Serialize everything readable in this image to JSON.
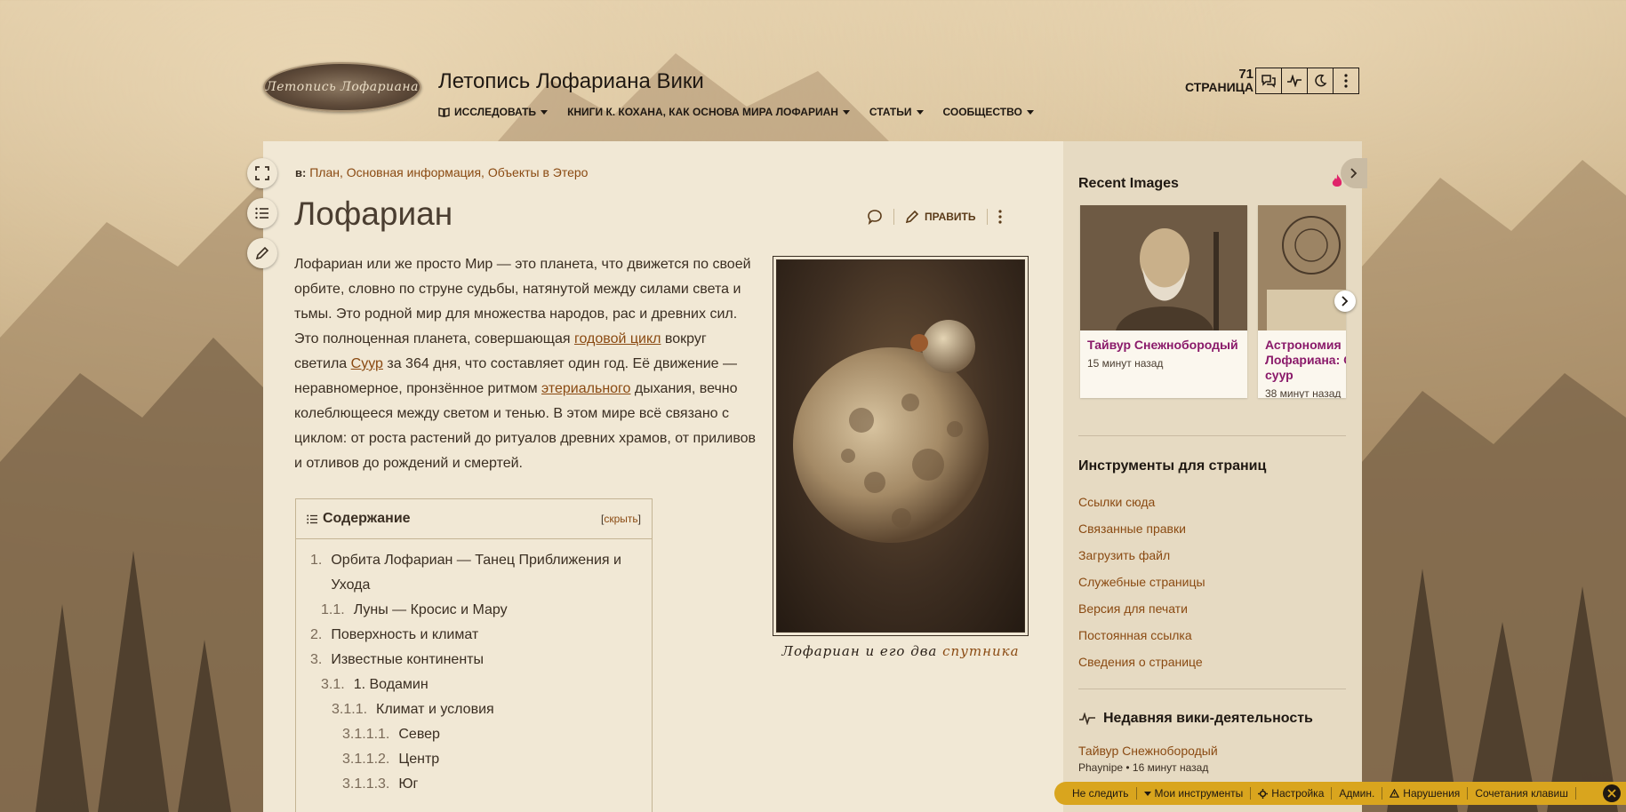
{
  "header": {
    "logo_text": "Летопись Лофариана",
    "wiki_title": "Летопись Лофариана Вики",
    "nav": [
      {
        "label": "Исследовать"
      },
      {
        "label": "Книги К. Кохана, как основа мира Лофариан"
      },
      {
        "label": "Статьи"
      },
      {
        "label": "Сообщество"
      }
    ],
    "pages_count": "71",
    "pages_label": "СТРАНИЦА"
  },
  "article": {
    "categories_prefix": "в:",
    "categories": "План, Основная информация, Объекты в Этеро",
    "title": "Лофариан",
    "edit_label": "Править",
    "intro_parts": {
      "p1": "Лофариан или же просто Мир — это планета, что движется по своей орбите, словно по струне судьбы, натянутой между силами света и тьмы. Это родной мир для множества народов, рас и древних сил. Это полноценная планета, совершающая ",
      "l1": "годовой цикл",
      "p2": " вокруг светила ",
      "l2": "Суур",
      "p3": " за 364 дня, что составляет один год. Её движение — неравномерное, пронзённое ритмом ",
      "l3": "этериального",
      "p4": " дыхания, вечно колеблющееся между светом и тенью. В этом мире всё связано с циклом: от роста растений до ритуалов древних храмов, от приливов и отливов до рождений и смертей."
    },
    "caption_text": "Лофариан и его два ",
    "caption_link": "спутника",
    "toc": {
      "title": "Содержание",
      "hide_label": "скрыть",
      "items": [
        {
          "num": "1.",
          "text": "Орбита Лофариан — Танец Приближения и Ухода",
          "indent": 0
        },
        {
          "num": "1.1.",
          "text": "Луны — Кросис и Мару",
          "indent": 1
        },
        {
          "num": "2.",
          "text": "Поверхность и климат",
          "indent": 0
        },
        {
          "num": "3.",
          "text": "Известные континенты",
          "indent": 0
        },
        {
          "num": "3.1.",
          "text": "1. Водамин",
          "indent": 1
        },
        {
          "num": "3.1.1.",
          "text": "Климат и условия",
          "indent": 2
        },
        {
          "num": "3.1.1.1.",
          "text": "Север",
          "indent": 3
        },
        {
          "num": "3.1.1.2.",
          "text": "Центр",
          "indent": 3
        },
        {
          "num": "3.1.1.3.",
          "text": "Юг",
          "indent": 3
        }
      ]
    }
  },
  "rail": {
    "recent_images_title": "Recent Images",
    "images": [
      {
        "title": "Тайвур Снежнобородый",
        "time": "15 минут назад"
      },
      {
        "title": "Астрономия Лофариана: Орбиты, суур",
        "time": "38 минут назад"
      }
    ],
    "tools_title": "Инструменты для страниц",
    "tools": [
      "Ссылки сюда",
      "Связанные правки",
      "Загрузить файл",
      "Служебные страницы",
      "Версия для печати",
      "Постоянная ссылка",
      "Сведения о странице"
    ],
    "activity_title": "Недавняя вики-деятельность",
    "activity": [
      {
        "title": "Тайвур Снежнобородый",
        "meta": "Phaynipe • 16 минут назад"
      }
    ]
  },
  "bottombar": [
    {
      "label": "Не следить"
    },
    {
      "label": "Мои инструменты"
    },
    {
      "label": "Настройка"
    },
    {
      "label": "Админ."
    },
    {
      "label": "Нарушения"
    },
    {
      "label": "Сочетания клавиш"
    }
  ],
  "colors": {
    "link": "#8a4a12",
    "sheet": "#f1e8d5",
    "rail": "#e6dac2",
    "toolbar": "#d9a51e"
  }
}
